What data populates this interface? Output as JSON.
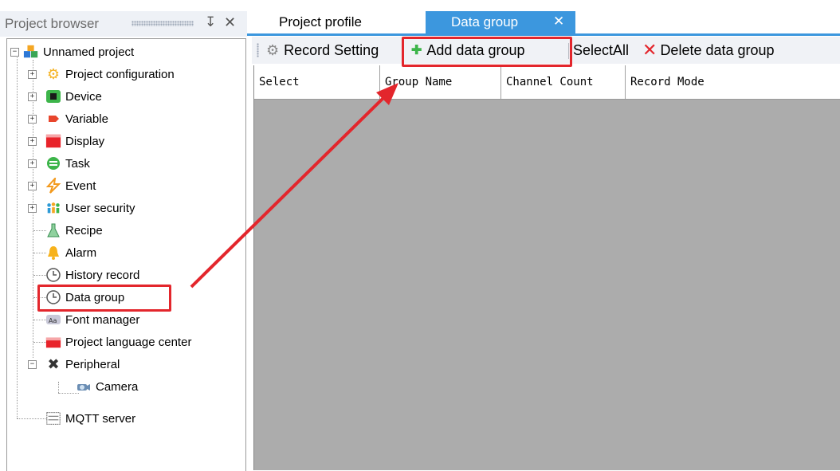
{
  "left_panel": {
    "title": "Project browser",
    "tree": [
      {
        "label": "Unnamed project",
        "icon": "project-icon"
      },
      {
        "label": "Project configuration",
        "icon": "gear-icon"
      },
      {
        "label": "Device",
        "icon": "device-icon"
      },
      {
        "label": "Variable",
        "icon": "variable-tag-icon"
      },
      {
        "label": "Display",
        "icon": "display-icon"
      },
      {
        "label": "Task",
        "icon": "task-icon"
      },
      {
        "label": "Event",
        "icon": "event-icon"
      },
      {
        "label": "User security",
        "icon": "users-icon"
      },
      {
        "label": "Recipe",
        "icon": "recipe-flask-icon"
      },
      {
        "label": "Alarm",
        "icon": "bell-icon"
      },
      {
        "label": "History record",
        "icon": "clock-icon"
      },
      {
        "label": "Data group",
        "icon": "clock-icon"
      },
      {
        "label": "Font manager",
        "icon": "font-icon"
      },
      {
        "label": "Project language center",
        "icon": "language-icon"
      },
      {
        "label": "Peripheral",
        "icon": "tools-icon"
      },
      {
        "label": "Camera",
        "icon": "camera-icon"
      },
      {
        "label": "MQTT server",
        "icon": "server-icon"
      }
    ]
  },
  "tabs": [
    {
      "label": "Project profile",
      "active": false
    },
    {
      "label": "Data group",
      "active": true
    }
  ],
  "toolbar": {
    "record_setting": "Record Setting",
    "add_group": "Add data group",
    "select_all": "SelectAll",
    "delete_group": "Delete data group"
  },
  "grid": {
    "columns": [
      "Select",
      "Group Name",
      "Channel Count",
      "Record Mode"
    ],
    "rows": []
  },
  "colors": {
    "accent": "#3c97de",
    "callout": "#e3262c",
    "grid_background": "#acacac"
  }
}
